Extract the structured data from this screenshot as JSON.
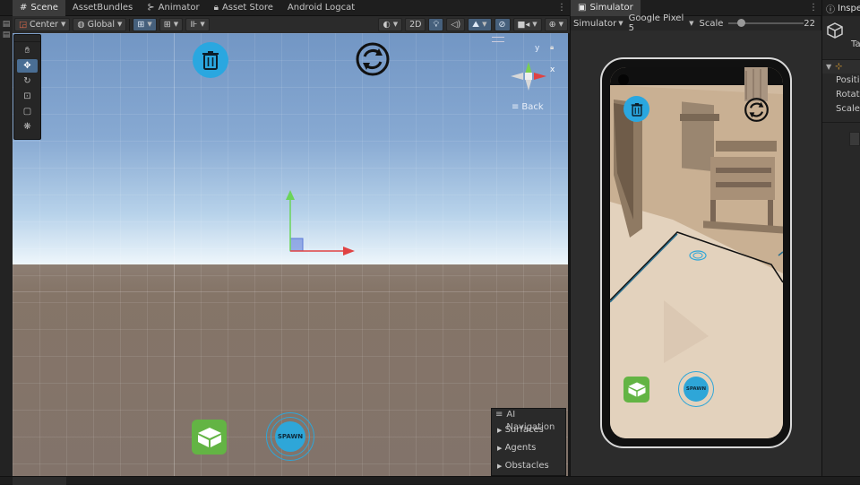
{
  "tabs_left": [
    {
      "label": "Scene",
      "icon": "hash-icon",
      "active": true
    },
    {
      "label": "AssetBundles",
      "icon": "",
      "active": false
    },
    {
      "label": "Animator",
      "icon": "animator-icon",
      "active": false
    },
    {
      "label": "Asset Store",
      "icon": "lock-icon",
      "active": false
    },
    {
      "label": "Android Logcat",
      "icon": "",
      "active": false
    }
  ],
  "tab_simulator": "Simulator",
  "tab_inspector": "Inspe",
  "scene_toolbar": {
    "pivot_label": "Center",
    "space_label": "Global",
    "mode_2d": "2D"
  },
  "gizmo": {
    "x_label": "x",
    "y_label": "y",
    "back_label": "Back"
  },
  "scene_overlay": {
    "spawn_label": "SPAWN"
  },
  "ai_navigation": {
    "title": "AI Navigation",
    "items": [
      "Surfaces",
      "Agents",
      "Obstacles"
    ]
  },
  "simulator": {
    "mode": "Simulator",
    "device": "Google Pixel 5",
    "scale_label": "Scale",
    "scale_value": "22",
    "scale_fraction": 0.13,
    "spawn_label": "SPAWN"
  },
  "inspector": {
    "tag_label": "Ta",
    "rows": [
      "Positi",
      "Rotati",
      "Scale"
    ]
  },
  "colors": {
    "trash_blue": "#2aa7e0",
    "spawn_blue": "#2ea6d8",
    "cube_green": "#63b444",
    "axis_x": "#e04343",
    "axis_y": "#6bd45a",
    "axis_z": "#5a78d8"
  }
}
